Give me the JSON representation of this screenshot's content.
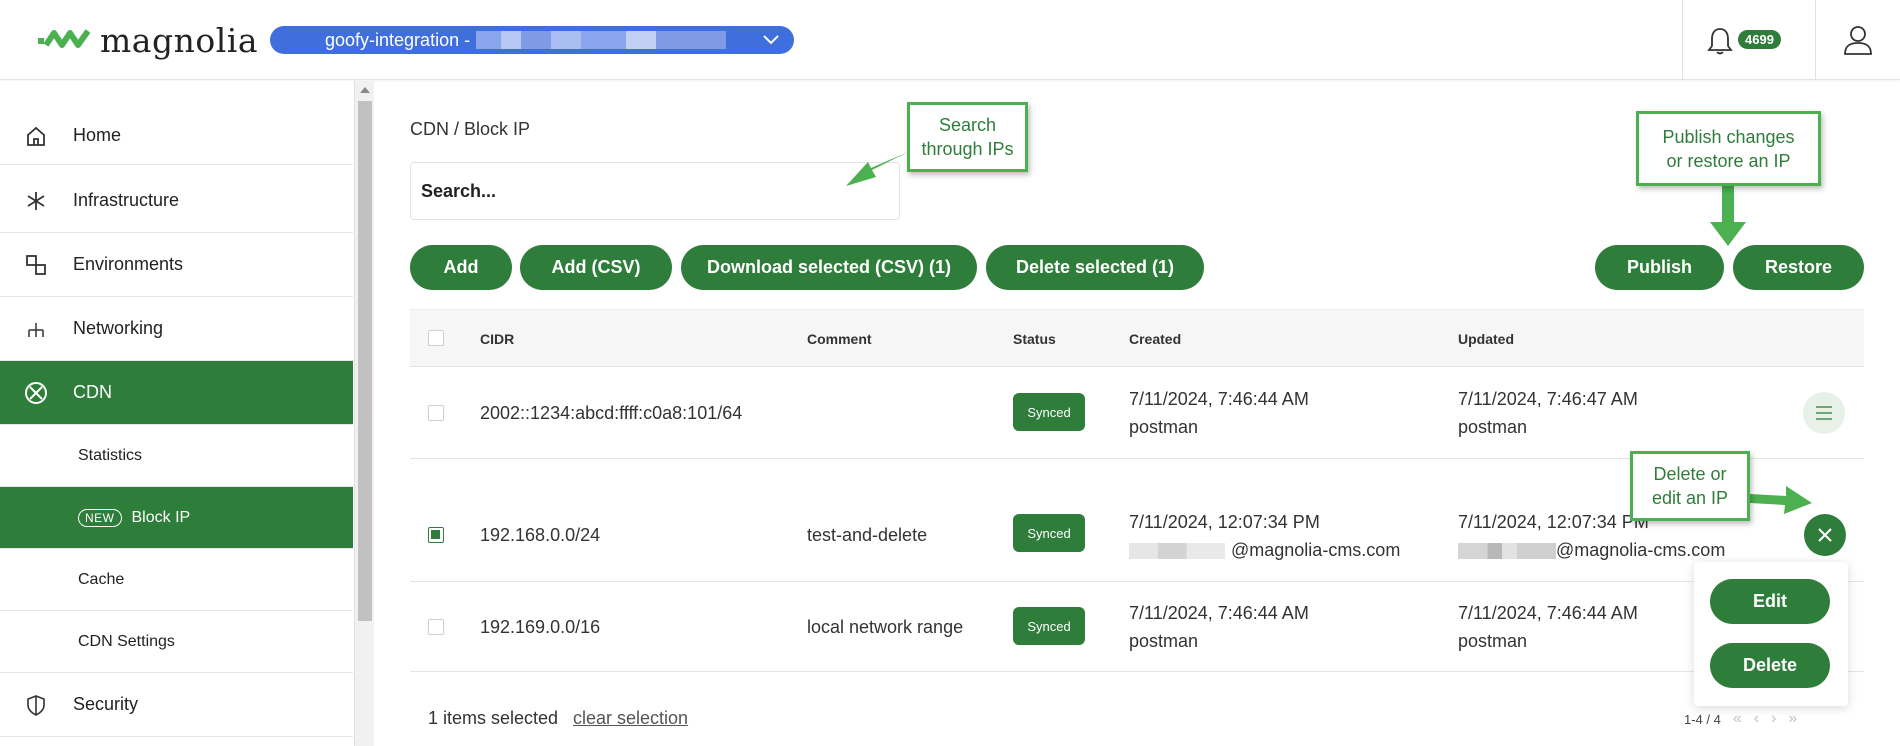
{
  "header": {
    "logo_text": "magnolia",
    "env_label": "goofy-integration -",
    "notification_count": "4699",
    "brand_color": "#2e7d3a",
    "env_color": "#3f6fdc"
  },
  "sidebar": {
    "items": [
      {
        "label": "Home",
        "icon": "home-icon"
      },
      {
        "label": "Infrastructure",
        "icon": "infrastructure-icon"
      },
      {
        "label": "Environments",
        "icon": "environments-icon"
      },
      {
        "label": "Networking",
        "icon": "networking-icon"
      },
      {
        "label": "CDN",
        "icon": "cdn-icon"
      },
      {
        "label": "Statistics"
      },
      {
        "label": "Block IP",
        "tag": "NEW"
      },
      {
        "label": "Cache"
      },
      {
        "label": "CDN Settings"
      },
      {
        "label": "Security",
        "icon": "shield-icon"
      }
    ]
  },
  "main": {
    "breadcrumb": "CDN / Block IP",
    "search_placeholder": "Search...",
    "buttons": {
      "add": "Add",
      "add_csv": "Add (CSV)",
      "download": "Download selected (CSV) (1)",
      "delete": "Delete selected (1)",
      "publish": "Publish",
      "restore": "Restore"
    },
    "table": {
      "columns": [
        "CIDR",
        "Comment",
        "Status",
        "Created",
        "Updated"
      ],
      "rows": [
        {
          "cidr": "2002::1234:abcd:ffff:c0a8:101/64",
          "comment": "",
          "status": "Synced",
          "created": "7/11/2024, 7:46:44 AM",
          "created_by": "postman",
          "updated": "7/11/2024, 7:46:47 AM",
          "updated_by": "postman",
          "selected": false
        },
        {
          "cidr": "192.168.0.0/24",
          "comment": "test-and-delete",
          "status": "Synced",
          "created": "7/11/2024, 12:07:34 PM",
          "created_by": "@magnolia-cms.com",
          "updated": "7/11/2024, 12:07:34 PM",
          "updated_by": "@magnolia-cms.com",
          "selected": true
        },
        {
          "cidr": "192.169.0.0/16",
          "comment": "local network range",
          "status": "Synced",
          "created": "7/11/2024, 7:46:44 AM",
          "created_by": "postman",
          "updated": "7/11/2024, 7:46:44 AM",
          "updated_by": "postman",
          "selected": false
        }
      ]
    },
    "row_menu": {
      "edit": "Edit",
      "delete": "Delete"
    },
    "footer": {
      "selected_text": "1 items selected",
      "clear_text": "clear selection",
      "pagination": "1-4 / 4"
    }
  },
  "callouts": {
    "search": "Search\nthrough IPs",
    "publish": "Publish changes\nor restore an IP",
    "delete": "Delete or\nedit an IP"
  }
}
